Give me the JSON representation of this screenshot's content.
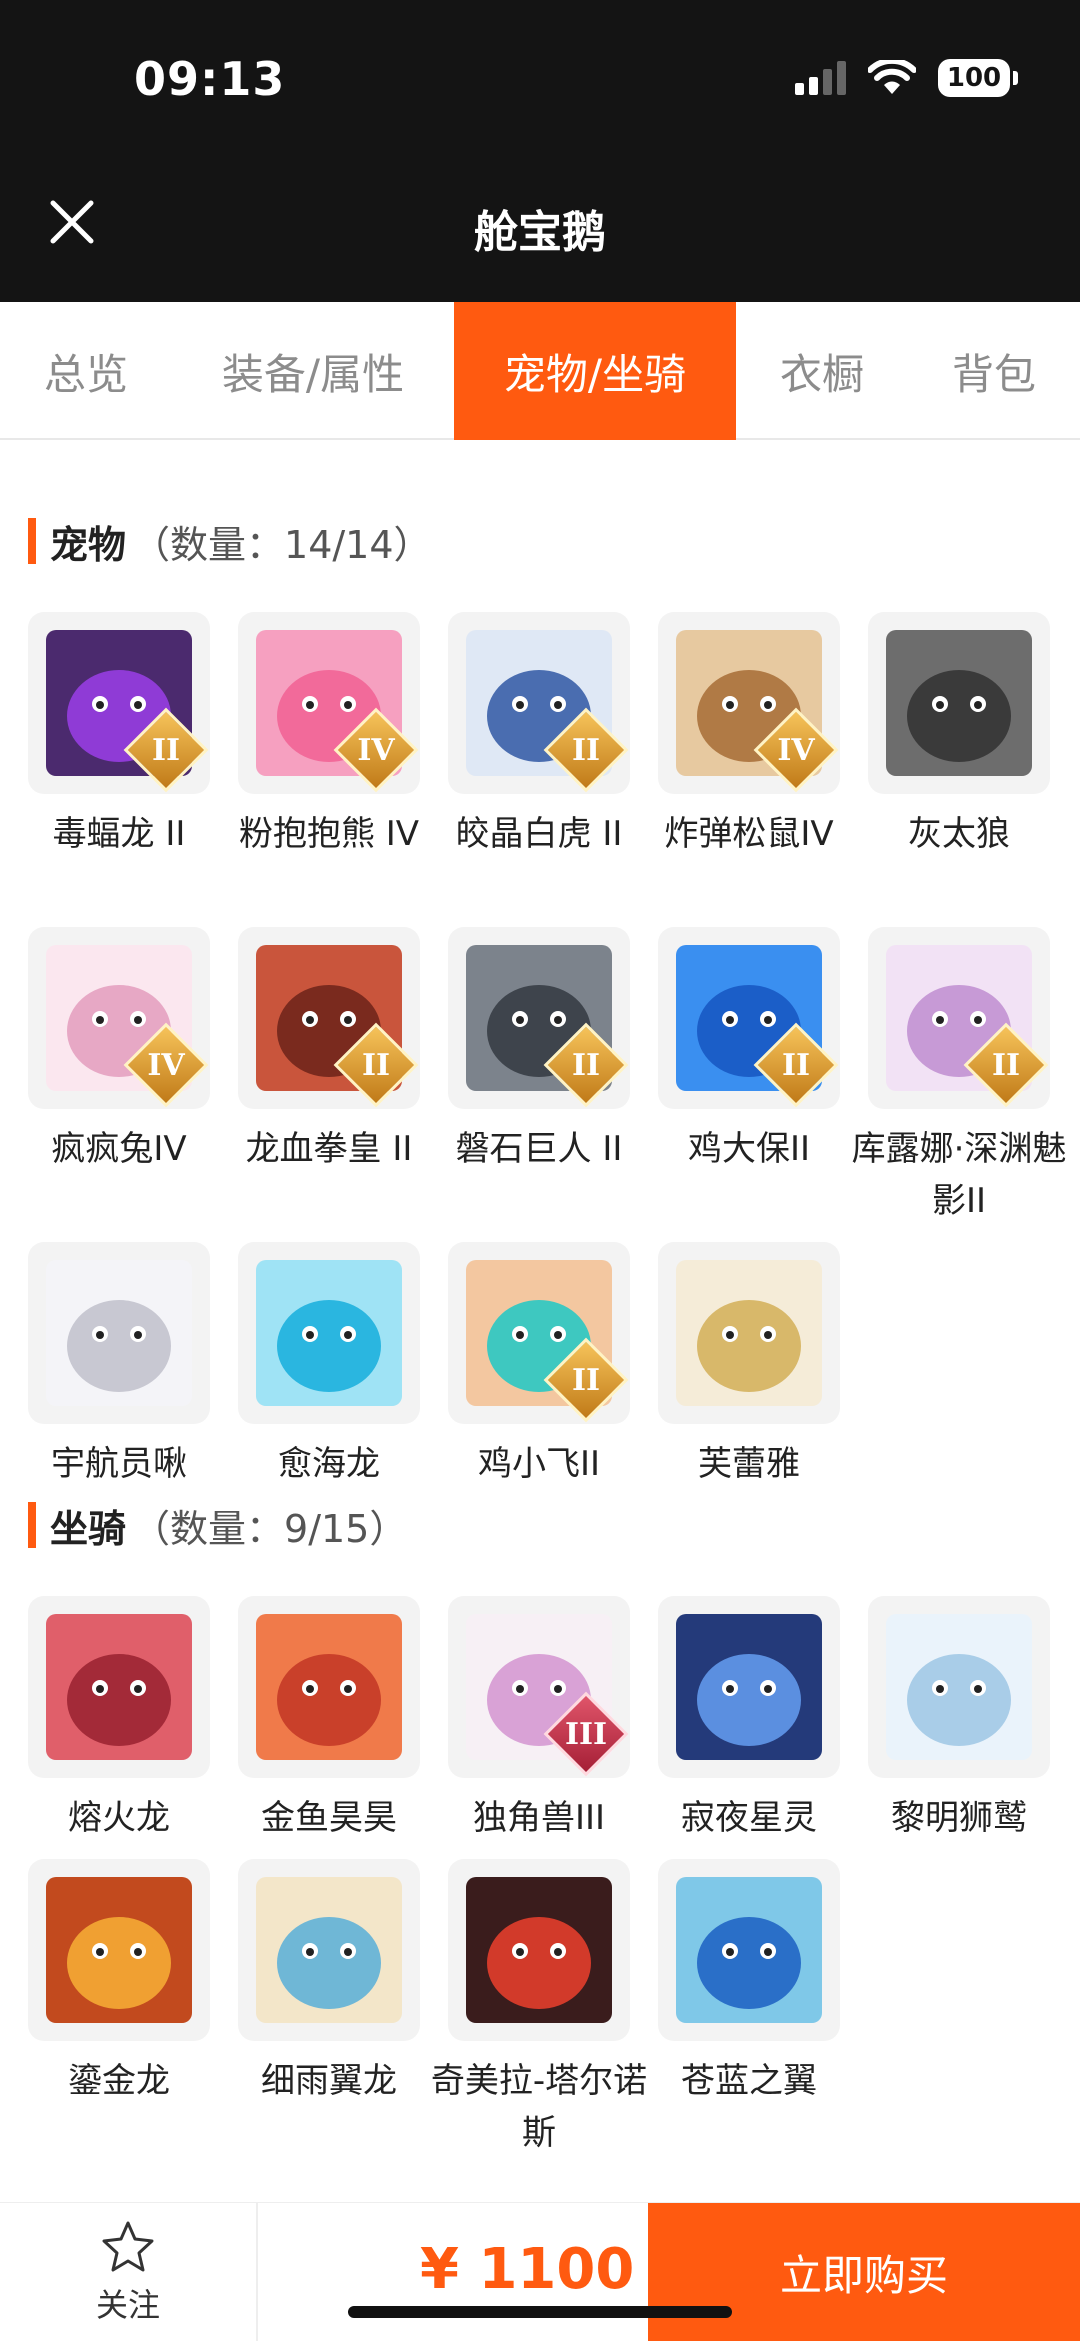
{
  "status_bar": {
    "time": "09:13",
    "battery": "100"
  },
  "header": {
    "title": "舱宝鹅"
  },
  "tabs": [
    {
      "label": "总览",
      "active": false
    },
    {
      "label": "装备/属性",
      "active": false
    },
    {
      "label": "宠物/坐骑",
      "active": true
    },
    {
      "label": "衣橱",
      "active": false
    },
    {
      "label": "背包",
      "active": false
    }
  ],
  "pets": {
    "title": "宠物",
    "count": "（数量：14/14）",
    "items": [
      {
        "name": "毒蝠龙 II",
        "grade": "II"
      },
      {
        "name": "粉抱抱熊 IV",
        "grade": "IV"
      },
      {
        "name": "皎晶白虎 II",
        "grade": "II"
      },
      {
        "name": "炸弹松鼠IV",
        "grade": "IV"
      },
      {
        "name": "灰太狼",
        "grade": ""
      },
      {
        "name": "疯疯兔IV",
        "grade": "IV"
      },
      {
        "name": "龙血拳皇 II",
        "grade": "II"
      },
      {
        "name": "磐石巨人 II",
        "grade": "II"
      },
      {
        "name": "鸡大保II",
        "grade": "II"
      },
      {
        "name": "库露娜·深渊魅影II",
        "grade": "II"
      },
      {
        "name": "宇航员啾",
        "grade": ""
      },
      {
        "name": "愈海龙",
        "grade": ""
      },
      {
        "name": "鸡小飞II",
        "grade": "II"
      },
      {
        "name": "芙蕾雅",
        "grade": ""
      }
    ]
  },
  "mounts": {
    "title": "坐骑",
    "count": "（数量：9/15）",
    "items": [
      {
        "name": "熔火龙",
        "grade": ""
      },
      {
        "name": "金鱼昊昊",
        "grade": ""
      },
      {
        "name": "独角兽III",
        "grade": "III"
      },
      {
        "name": "寂夜星灵",
        "grade": ""
      },
      {
        "name": "黎明狮鹫",
        "grade": ""
      },
      {
        "name": "鎏金龙",
        "grade": ""
      },
      {
        "name": "细雨翼龙",
        "grade": ""
      },
      {
        "name": "奇美拉-塔尔诺斯",
        "grade": ""
      },
      {
        "name": "苍蓝之翼",
        "grade": ""
      }
    ]
  },
  "bottom_bar": {
    "follow_label": "关注",
    "price": "¥ 1100",
    "buy_label": "立即购买"
  },
  "colors": {
    "accent": "#ff5a10",
    "header_bg": "#141414"
  }
}
